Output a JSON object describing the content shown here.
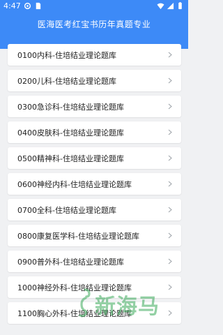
{
  "status_bar": {
    "time": "4:47"
  },
  "header": {
    "title": "医海医考红宝书历年真题专业"
  },
  "list": {
    "items": [
      {
        "label": "0100内科-住培结业理论题库"
      },
      {
        "label": "0200儿科-住培结业理论题库"
      },
      {
        "label": "0300急诊科-住培结业理论题库"
      },
      {
        "label": "0400皮肤科-住培结业理论题库"
      },
      {
        "label": "0500精神科-住培结业理论题库"
      },
      {
        "label": "0600神经内科-住培结业理论题库"
      },
      {
        "label": "0700全科-住培结业理论题库"
      },
      {
        "label": "0800康复医学科-住培结业理论题库"
      },
      {
        "label": "0900普外科-住培结业理论题库"
      },
      {
        "label": "1000神经外科-住培结业理论题库"
      },
      {
        "label": "1100胸心外科-住培结业理论题库"
      }
    ]
  },
  "watermark": {
    "text": "新海马"
  },
  "colors": {
    "accent": "#3d8af7",
    "background": "#f0f1f3",
    "chevron": "#9aa0a6"
  }
}
